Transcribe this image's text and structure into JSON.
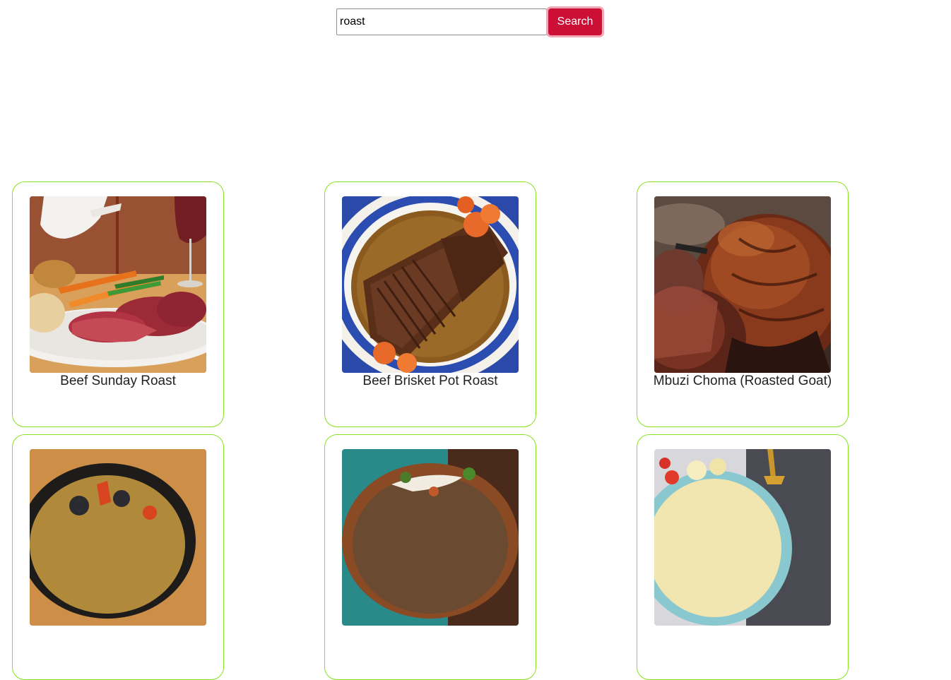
{
  "search": {
    "value": "roast",
    "button_label": "Search"
  },
  "recipes": [
    {
      "title": "Beef Sunday Roast"
    },
    {
      "title": "Beef Brisket Pot Roast"
    },
    {
      "title": "Mbuzi Choma (Roasted Goat)"
    },
    {
      "title": ""
    },
    {
      "title": ""
    },
    {
      "title": ""
    }
  ],
  "colors": {
    "card_border": "#86e21f",
    "button_bg": "#cc0f35",
    "button_ring": "#f2a7b6"
  }
}
